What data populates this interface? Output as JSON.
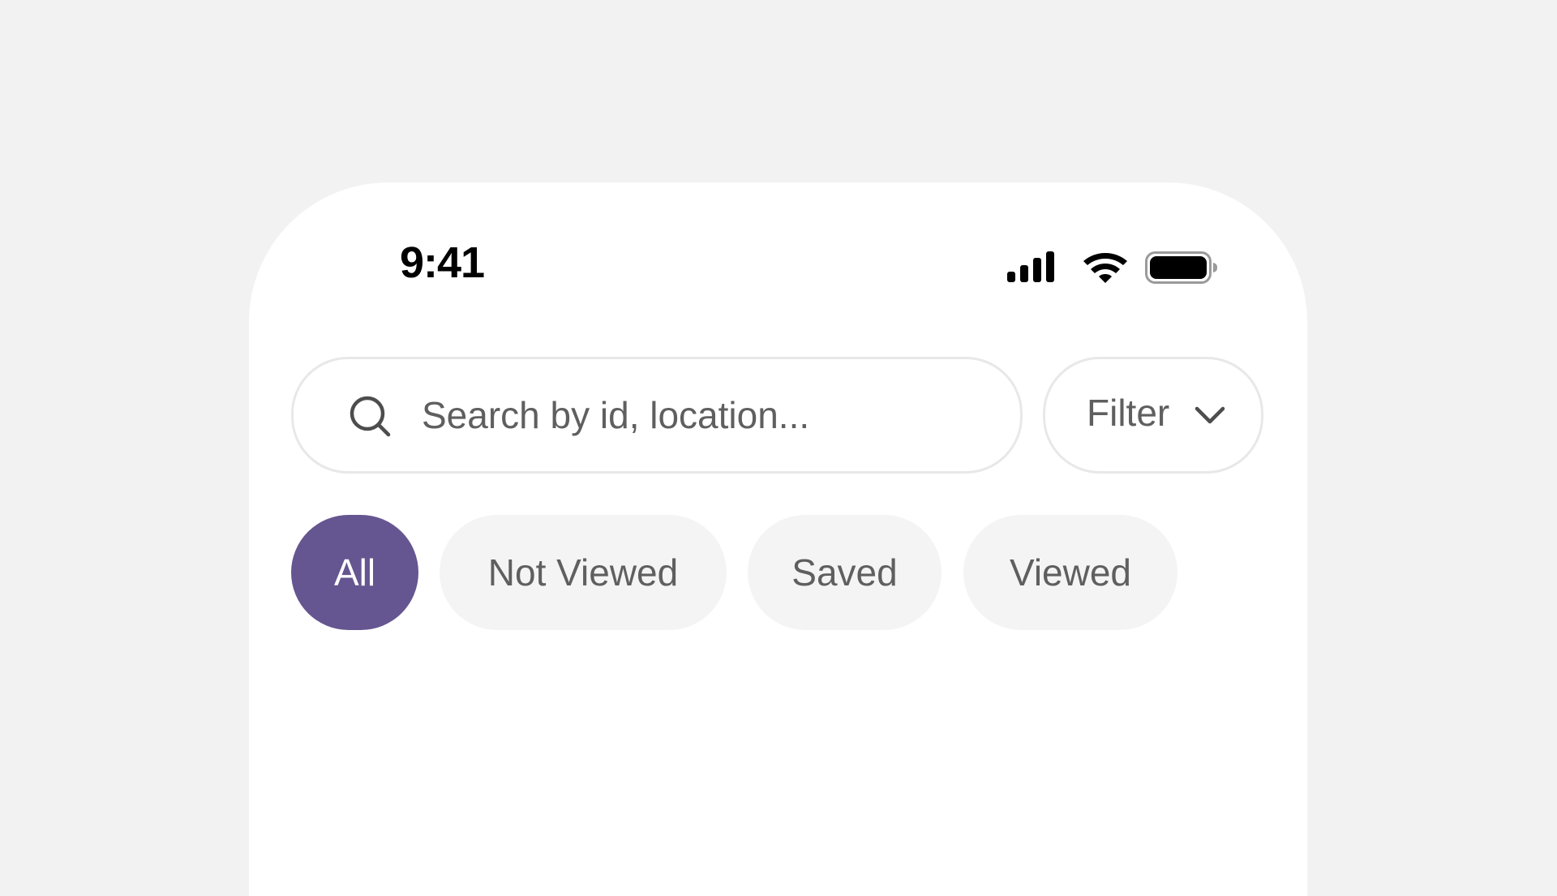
{
  "status_bar": {
    "time": "9:41",
    "icons": [
      "signal-icon",
      "wifi-icon",
      "battery-icon"
    ]
  },
  "search": {
    "placeholder": "Search by id, location...",
    "value": "",
    "icon": "search-icon"
  },
  "filter": {
    "label": "Filter",
    "icon": "chevron-down-icon"
  },
  "chips": [
    {
      "label": "All",
      "selected": true
    },
    {
      "label": "Not Viewed",
      "selected": false
    },
    {
      "label": "Saved",
      "selected": false
    },
    {
      "label": "Viewed",
      "selected": false
    }
  ],
  "colors": {
    "accent": "#655590",
    "background": "#f2f2f2",
    "surface": "#ffffff",
    "chip_background": "#f4f4f4",
    "text_secondary": "#5f5f5f",
    "border": "#e8e8e8"
  }
}
